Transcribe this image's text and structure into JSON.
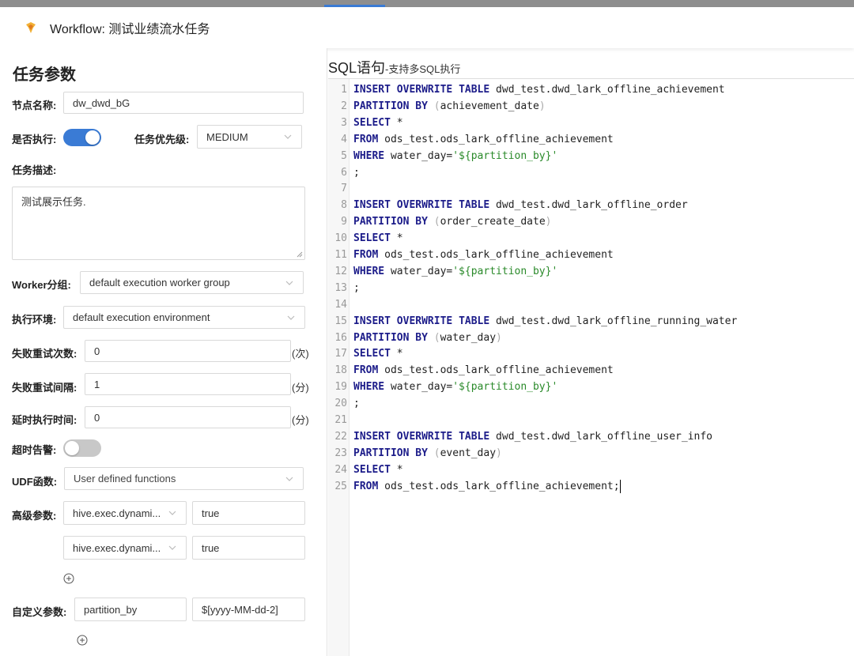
{
  "header": {
    "title": "Workflow: 测试业绩流水任务"
  },
  "left": {
    "section_title": "任务参数",
    "node_name": {
      "label": "节点名称:",
      "value": "dw_dwd_bG"
    },
    "execute": {
      "label": "是否执行:",
      "on": true
    },
    "priority": {
      "label": "任务优先级:",
      "value": "MEDIUM"
    },
    "description": {
      "label": "任务描述:",
      "value": "测试展示任务."
    },
    "worker_group": {
      "label": "Worker分组:",
      "value": "default execution worker group"
    },
    "environment": {
      "label": "执行环境:",
      "value": "default execution environment"
    },
    "retry_times": {
      "label": "失败重试次数:",
      "value": "0",
      "unit": "(次)"
    },
    "retry_interval": {
      "label": "失败重试间隔:",
      "value": "1",
      "unit": "(分)"
    },
    "delay_time": {
      "label": "延时执行时间:",
      "value": "0",
      "unit": "(分)"
    },
    "timeout_alert": {
      "label": "超时告警:",
      "on": false
    },
    "udf": {
      "label": "UDF函数:",
      "placeholder": "User defined functions"
    },
    "advanced": {
      "label": "高级参数:",
      "rows": [
        {
          "key": "hive.exec.dynami...",
          "value": "true"
        },
        {
          "key": "hive.exec.dynami...",
          "value": "true"
        }
      ]
    },
    "custom": {
      "label": "自定义参数:",
      "rows": [
        {
          "key": "partition_by",
          "value": "$[yyyy-MM-dd-2]"
        }
      ]
    }
  },
  "sql": {
    "title": "SQL语句",
    "subtitle": "-支持多SQL执行",
    "lines": [
      "INSERT OVERWRITE TABLE dwd_test.dwd_lark_offline_achievement",
      "PARTITION BY (achievement_date)",
      "SELECT *",
      "FROM ods_test.ods_lark_offline_achievement",
      "WHERE water_day='${partition_by}'",
      ";",
      "",
      "INSERT OVERWRITE TABLE dwd_test.dwd_lark_offline_order",
      "PARTITION BY (order_create_date)",
      "SELECT *",
      "FROM ods_test.ods_lark_offline_achievement",
      "WHERE water_day='${partition_by}'",
      ";",
      "",
      "INSERT OVERWRITE TABLE dwd_test.dwd_lark_offline_running_water",
      "PARTITION BY (water_day)",
      "SELECT *",
      "FROM ods_test.ods_lark_offline_achievement",
      "WHERE water_day='${partition_by}'",
      ";",
      "",
      "INSERT OVERWRITE TABLE dwd_test.dwd_lark_offline_user_info",
      "PARTITION BY (event_day)",
      "SELECT *",
      "FROM ods_test.ods_lark_offline_achievement;"
    ]
  }
}
